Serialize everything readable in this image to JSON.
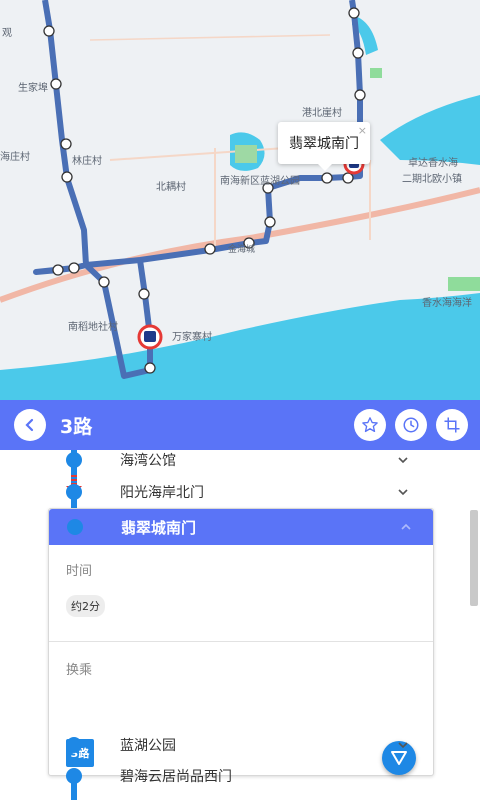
{
  "colors": {
    "accent": "#5a74f7",
    "route": "#1e88e5",
    "map_line": "#4a6fb5",
    "water": "#4bc9ea"
  },
  "map": {
    "labels": [
      "观",
      "生家埠",
      "海庄村",
      "林庄村",
      "北耦村",
      "港北崖村",
      "南海新区蓝湖公园",
      "卓达香水海",
      "二期北欧小镇",
      "金海城",
      "南稻地社村",
      "万家寨村",
      "香水海海洋"
    ],
    "popup": {
      "title": "翡翠城南门",
      "close": "×"
    }
  },
  "toolbar": {
    "title": "3路",
    "back_icon": "chevron-left-icon",
    "actions": [
      "star-icon",
      "clock-icon",
      "crop-icon"
    ]
  },
  "stops": [
    {
      "name": "海湾公馆"
    },
    {
      "name": "阳光海岸北门"
    },
    {
      "name": "翡翠城南门",
      "expanded": true
    },
    {
      "name": "蓝湖公园"
    },
    {
      "name": "碧海云居尚品西门"
    }
  ],
  "detail": {
    "time_label": "时间",
    "time_value": "约2分",
    "transfer_label": "换乘",
    "transfer_routes": [
      "3路"
    ]
  }
}
